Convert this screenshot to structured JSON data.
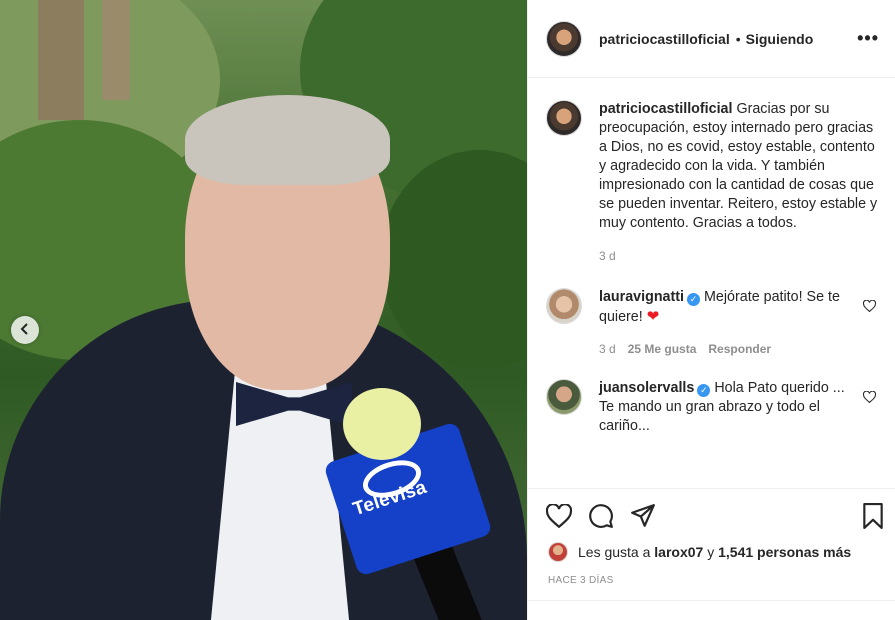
{
  "post": {
    "username": "patriciocastilloficial",
    "separator": "•",
    "follow_status": "Siguiendo",
    "more": "•••"
  },
  "caption": {
    "username": "patriciocastilloficial",
    "text": "Gracias por su preocupación, estoy internado pero gracias a Dios, no es covid, estoy estable, contento y agradecido con la vida. Y también impresionado con la cantidad de cosas que se pueden inventar. Reitero, estoy estable y muy contento. Gracias a todos.",
    "age": "3 d"
  },
  "comments": [
    {
      "username": "lauravignatti",
      "verified": true,
      "text": "Mejórate patito! Se te quiere!",
      "emoji": "❤",
      "age": "3 d",
      "likes": "25 Me gusta",
      "reply": "Responder"
    },
    {
      "username": "juansolervalls",
      "verified": true,
      "text": "Hola Pato querido ... Te mando un gran abrazo y todo el cariño..."
    }
  ],
  "likes": {
    "prefix": "Les gusta a",
    "user": "larox07",
    "and": "y",
    "others": "1,541 personas más"
  },
  "timestamp": "HACE 3 DÍAS",
  "photo": {
    "mic_brand": "Televisa"
  },
  "colors": {
    "verified": "#3897f0",
    "heart": "#ed1c24",
    "muted": "#8e8e8e"
  },
  "icons": [
    "chevron-left-icon",
    "more-icon",
    "heart-icon",
    "comment-icon",
    "share-icon",
    "bookmark-icon",
    "verified-icon"
  ]
}
